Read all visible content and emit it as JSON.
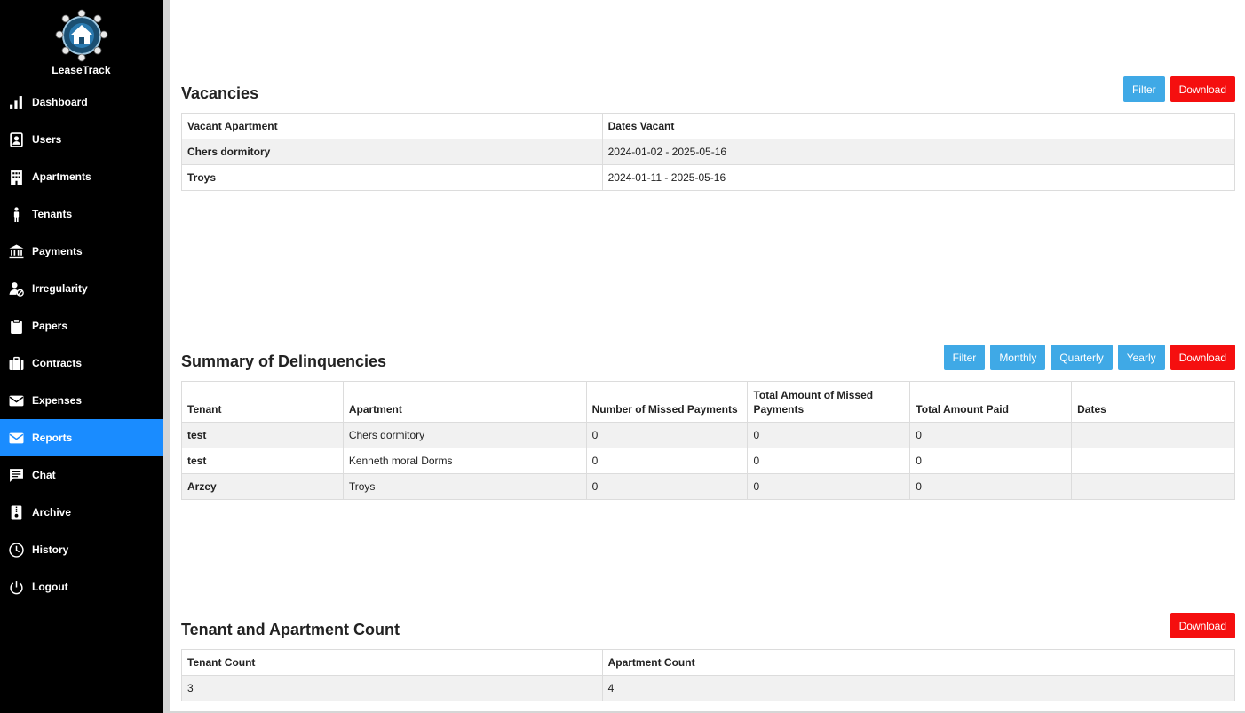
{
  "app": {
    "name": "LeaseTrack"
  },
  "sidebar": {
    "items": [
      {
        "label": "Dashboard",
        "icon": "bar-chart-icon",
        "active": false
      },
      {
        "label": "Users",
        "icon": "user-card-icon",
        "active": false
      },
      {
        "label": "Apartments",
        "icon": "building-icon",
        "active": false
      },
      {
        "label": "Tenants",
        "icon": "person-icon",
        "active": false
      },
      {
        "label": "Payments",
        "icon": "bank-icon",
        "active": false
      },
      {
        "label": "Irregularity",
        "icon": "user-blocked-icon",
        "active": false
      },
      {
        "label": "Papers",
        "icon": "clipboard-icon",
        "active": false
      },
      {
        "label": "Contracts",
        "icon": "suitcase-icon",
        "active": false
      },
      {
        "label": "Expenses",
        "icon": "envelope-icon",
        "active": false
      },
      {
        "label": "Reports",
        "icon": "envelope-icon",
        "active": true
      },
      {
        "label": "Chat",
        "icon": "chat-icon",
        "active": false
      },
      {
        "label": "Archive",
        "icon": "archive-icon",
        "active": false
      },
      {
        "label": "History",
        "icon": "clock-icon",
        "active": false
      },
      {
        "label": "Logout",
        "icon": "power-icon",
        "active": false
      }
    ]
  },
  "vacancies": {
    "title": "Vacancies",
    "buttons": {
      "filter": "Filter",
      "download": "Download"
    },
    "columns": [
      "Vacant Apartment",
      "Dates Vacant"
    ],
    "rows": [
      [
        "Chers dormitory",
        "2024-01-02 - 2025-05-16"
      ],
      [
        "Troys",
        "2024-01-11 - 2025-05-16"
      ]
    ]
  },
  "delinquencies": {
    "title": "Summary of Delinquencies",
    "buttons": {
      "filter": "Filter",
      "monthly": "Monthly",
      "quarterly": "Quarterly",
      "yearly": "Yearly",
      "download": "Download"
    },
    "columns": [
      "Tenant",
      "Apartment",
      "Number of Missed Payments",
      "Total Amount of Missed Payments",
      "Total Amount Paid",
      "Dates"
    ],
    "rows": [
      [
        "test",
        "Chers dormitory",
        "0",
        "0",
        "0",
        ""
      ],
      [
        "test",
        "Kenneth moral Dorms",
        "0",
        "0",
        "0",
        ""
      ],
      [
        "Arzey",
        "Troys",
        "0",
        "0",
        "0",
        ""
      ]
    ]
  },
  "counts": {
    "title": "Tenant and Apartment Count",
    "buttons": {
      "download": "Download"
    },
    "columns": [
      "Tenant Count",
      "Apartment Count"
    ],
    "rows": [
      [
        "3",
        "4"
      ]
    ]
  },
  "colors": {
    "sidebar_bg": "#000000",
    "active_nav": "#1a8cff",
    "filter_button": "#3fa9e6",
    "download_button": "#f50f0f"
  }
}
